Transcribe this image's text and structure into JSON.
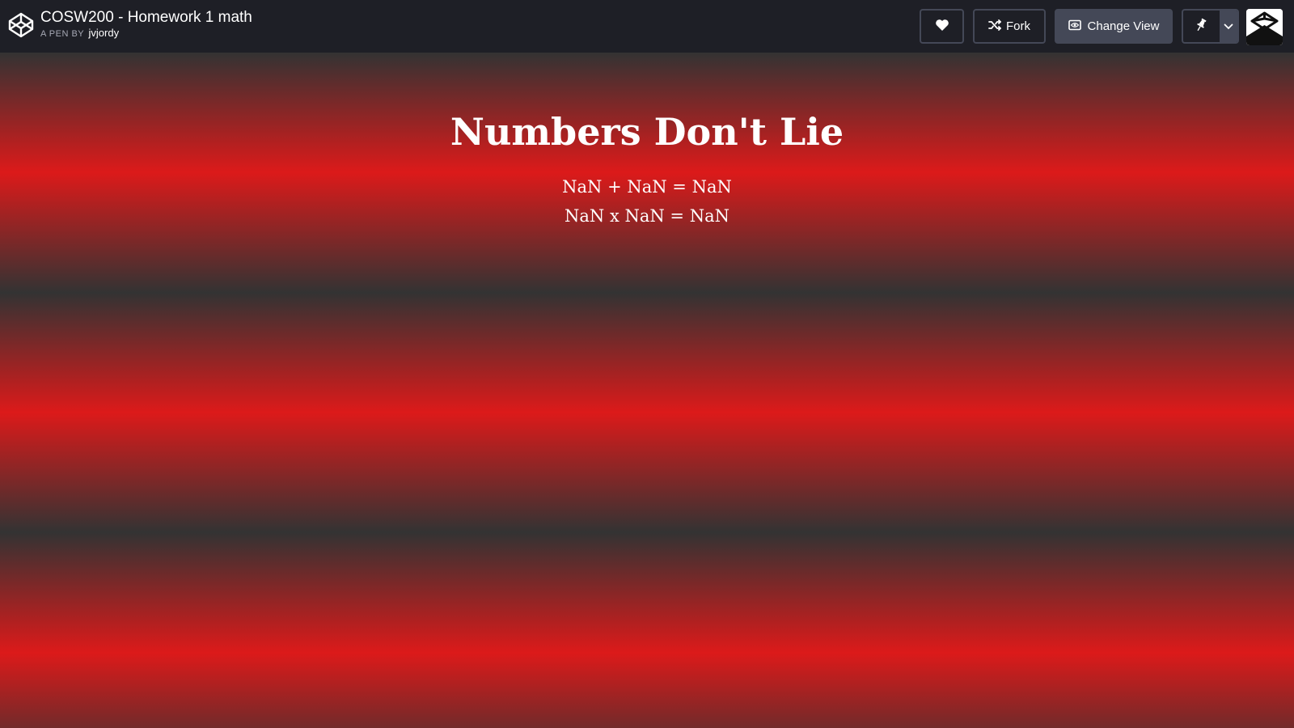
{
  "header": {
    "pen_title": "COSW200 - Homework 1 math",
    "byline_prefix": "A PEN BY",
    "author": "jvjordy",
    "fork_label": "Fork",
    "change_view_label": "Change View",
    "icons": [
      "codepen-logo-icon",
      "heart-icon",
      "fork-icon",
      "eye-icon",
      "pin-icon",
      "chevron-down-icon",
      "avatar"
    ]
  },
  "content": {
    "heading": "Numbers Don't Lie",
    "equations": [
      "NaN + NaN = NaN",
      "NaN x NaN = NaN"
    ]
  },
  "colors": {
    "topbar": "#1e1f26",
    "button_border": "#444857",
    "stripe_red": "#dc1a1a",
    "stripe_dark": "#333333",
    "text": "#ffffff"
  }
}
